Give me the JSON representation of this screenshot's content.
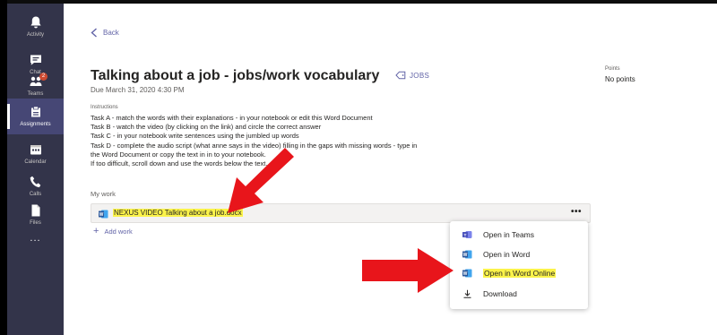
{
  "rail": {
    "items": [
      {
        "label": "Activity",
        "icon": "bell-icon"
      },
      {
        "label": "Chat",
        "icon": "chat-icon"
      },
      {
        "label": "Teams",
        "icon": "teams-icon",
        "badge": "2"
      },
      {
        "label": "Assignments",
        "icon": "assignments-icon"
      },
      {
        "label": "Calendar",
        "icon": "calendar-icon"
      },
      {
        "label": "Calls",
        "icon": "phone-icon"
      },
      {
        "label": "Files",
        "icon": "files-icon"
      },
      {
        "label": "...",
        "icon": "more-apps-icon"
      }
    ],
    "active_index": 3
  },
  "header": {
    "back_label": "Back"
  },
  "assignment": {
    "title": "Talking about a job - jobs/work vocabulary",
    "tag": "JOBS",
    "due": "Due March 31, 2020 4:30 PM",
    "points_label": "Points",
    "points_value": "No points",
    "instructions_label": "Instructions",
    "instructions": [
      "Task A - match the words with their explanations - in your notebook or edit this   Word Document",
      "Task B - watch the video (by clicking on the link) and circle the correct answer",
      "Task C - in your notebook write sentences using the jumbled up words",
      "Task D - complete the audio script (what anne says in the video) filling in the gaps with missing words - type in",
      "the Word Document or copy the text  in in to your notebook.",
      "If too difficult, scroll down and use the words below the text."
    ]
  },
  "my_work": {
    "label": "My work",
    "file_name": "NEXUS VIDEO Talking about a job.docx",
    "more_label": "•••",
    "add_work_label": "Add work"
  },
  "menu": {
    "items": [
      {
        "label": "Open in Teams",
        "icon": "teams-app-icon",
        "highlighted": false
      },
      {
        "label": "Open in Word",
        "icon": "word-icon",
        "highlighted": false
      },
      {
        "label": "Open in Word Online",
        "icon": "word-online-icon",
        "highlighted": true
      },
      {
        "label": "Download",
        "icon": "download-icon",
        "highlighted": false
      }
    ]
  },
  "colors": {
    "rail": "#33344a",
    "rail_active": "#464775",
    "accent": "#6264a7",
    "highlight": "#fbf34a",
    "arrow": "#e8151b",
    "word_blue": "#2b579a"
  }
}
